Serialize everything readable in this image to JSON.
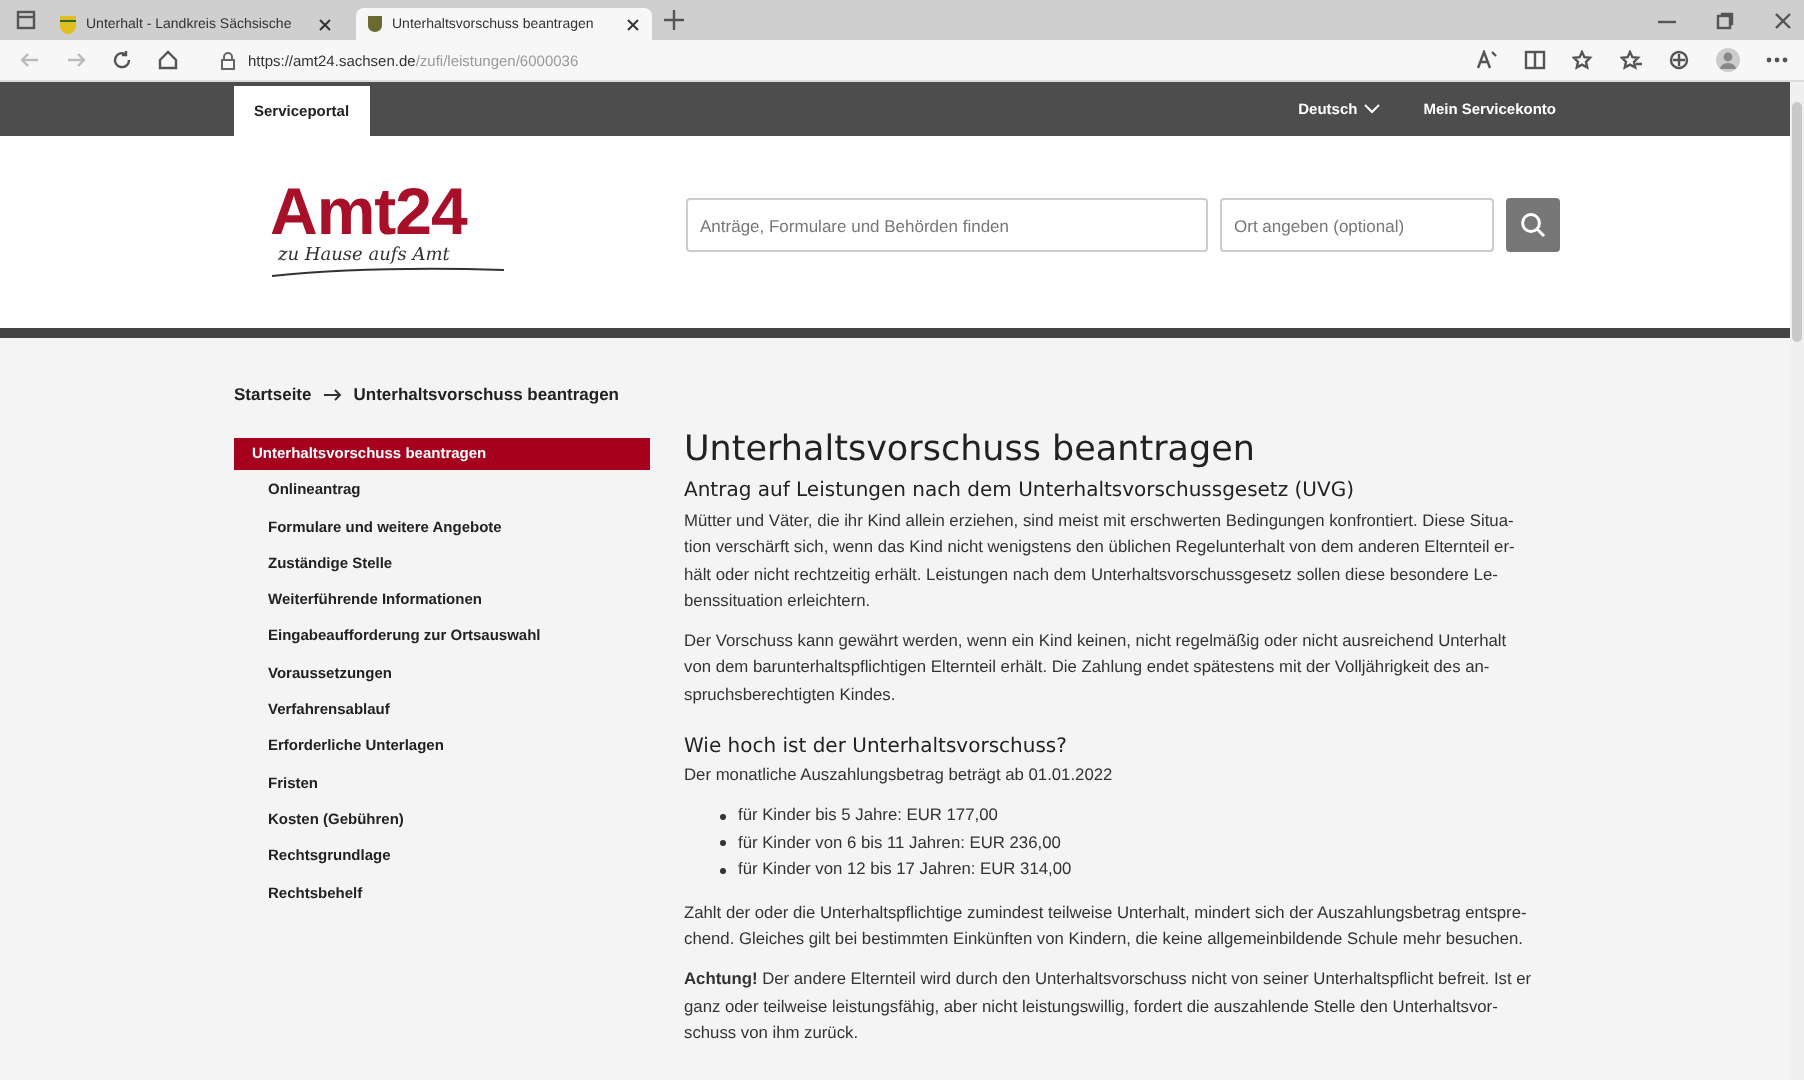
{
  "browser": {
    "tabs": [
      {
        "title": "Unterhalt - Landkreis Sächsische",
        "selected": false
      },
      {
        "title": "Unterhaltsvorschuss beantragen",
        "selected": true
      }
    ],
    "url_host": "https://amt24.sachsen.de",
    "url_path": "/zufi/leistungen/6000036"
  },
  "topbar": {
    "tabs": [
      {
        "label": "Serviceportal",
        "selected": true
      }
    ],
    "language": "Deutsch",
    "account": "Mein Servicekonto"
  },
  "header": {
    "logo": "Amt24",
    "tagline": "zu Hause aufs Amt",
    "search_placeholder": "Anträge, Formulare und Behörden finden",
    "location_placeholder": "Ort angeben (optional)"
  },
  "breadcrumb": [
    "Startseite",
    "Unterhaltsvorschuss beantragen"
  ],
  "sidebar": {
    "items": [
      {
        "label": "Unterhaltsvorschuss beantragen",
        "selected": true
      },
      {
        "label": "Onlineantrag",
        "selected": false
      },
      {
        "label": "Formulare und weitere Angebote",
        "selected": false
      },
      {
        "label": "Zuständige Stelle",
        "selected": false
      },
      {
        "label": "Weiterführende Informationen",
        "selected": false
      },
      {
        "label": "Eingabeaufforderung zur Ortsauswahl",
        "selected": false
      },
      {
        "label": "Voraussetzungen",
        "selected": false
      },
      {
        "label": "Verfahrensablauf",
        "selected": false
      },
      {
        "label": "Erforderliche Unterlagen",
        "selected": false
      },
      {
        "label": "Fristen",
        "selected": false
      },
      {
        "label": "Kosten (Gebühren)",
        "selected": false
      },
      {
        "label": "Rechtsgrundlage",
        "selected": false
      },
      {
        "label": "Rechtsbehelf",
        "selected": false
      }
    ]
  },
  "content": {
    "title": "Unterhaltsvorschuss beantragen",
    "subtitle": "Antrag auf Leistungen nach dem Unterhaltsvorschussgesetz (UVG)",
    "blocks": [
      {
        "kind": "paragraph",
        "lines": [
          "Mütter und Väter, die ihr Kind allein erziehen, sind meist mit erschwerten Bedingungen konfrontiert. Diese Situa-",
          "tion verschärft sich, wenn das Kind nicht wenigstens den üblichen Regelunterhalt von dem anderen Elternteil er-",
          "hält oder nicht rechtzeitig erhält. Leistungen nach dem Unterhaltsvorschussgesetz sollen diese besondere Le-",
          "benssituation erleichtern."
        ]
      },
      {
        "kind": "paragraph",
        "lines": [
          "Der Vorschuss kann gewährt werden, wenn ein Kind keinen, nicht regelmäßig oder nicht ausreichend Unterhalt",
          "von dem barunterhaltspflichtigen Elternteil erhält. Die Zahlung endet spätestens mit der Volljährigkeit des an-",
          "spruchsberechtigten Kindes."
        ]
      },
      {
        "kind": "heading",
        "text": "Wie hoch ist der Unterhaltsvorschuss?"
      },
      {
        "kind": "paragraph",
        "lines": [
          "Der monatliche Auszahlungsbetrag beträgt ab 01.01.2022"
        ]
      },
      {
        "kind": "list",
        "items": [
          "für Kinder bis 5 Jahre: EUR 177,00",
          "für Kinder von 6 bis 11 Jahren: EUR 236,00",
          "für Kinder von 12 bis 17 Jahren: EUR 314,00"
        ]
      },
      {
        "kind": "paragraph",
        "lines": [
          "Zahlt der oder die Unterhaltspflichtige zumindest teilweise Unterhalt, mindert sich der Auszahlungsbetrag entspre-",
          "chend. Gleiches gilt bei bestimmten Einkünften von Kindern, die keine allgemeinbildende Schule mehr besuchen."
        ]
      },
      {
        "kind": "paragraph",
        "lines": [
          "**Achtung!** Der andere Elternteil wird durch den Unterhaltsvorschuss nicht von seiner Unterhaltspflicht befreit. Ist er",
          "ganz oder teilweise leistungsfähig, aber nicht leistungswillig, fordert die auszahlende Stelle den Unterhaltsvor-",
          "schuss von ihm zurück."
        ]
      }
    ]
  }
}
